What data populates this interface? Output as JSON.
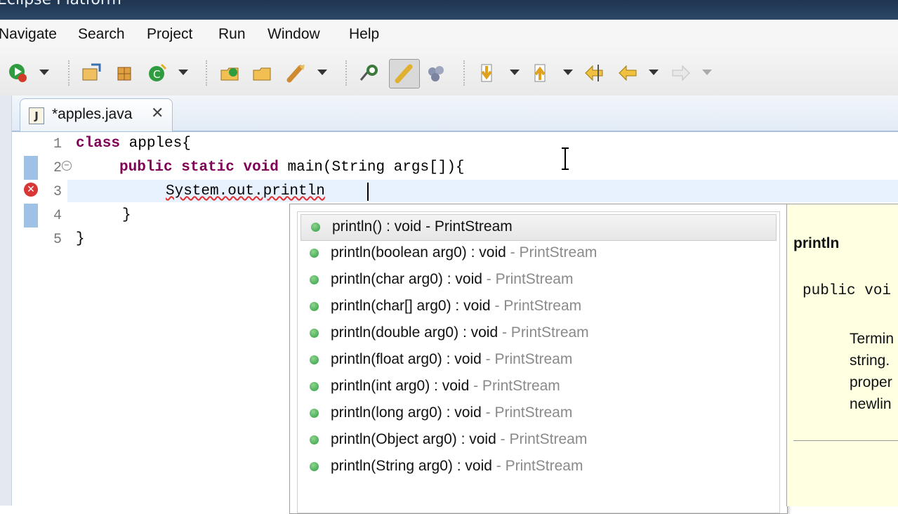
{
  "window": {
    "title": "Eclipse Platform"
  },
  "menu": [
    "Navigate",
    "Search",
    "Project",
    "Run",
    "Window",
    "Help"
  ],
  "toolbar": {
    "icons": [
      "run-icon",
      "new-java-project-icon",
      "new-package-icon",
      "new-class-icon",
      "open-type-icon",
      "open-folder-icon",
      "search-tool-icon",
      "debug-icon",
      "highlight-icon",
      "breakpoints-icon",
      "next-annotation-icon",
      "previous-annotation-icon",
      "last-edit-location-icon",
      "back-icon",
      "forward-icon"
    ]
  },
  "editor": {
    "tab_label": "*apples.java",
    "tab_icon": "J",
    "lines": [
      {
        "num": "1",
        "text": "class apples{"
      },
      {
        "num": "2",
        "text": "public static void main(String args[]){"
      },
      {
        "num": "3",
        "text": "System.out.println"
      },
      {
        "num": "4",
        "text": "}"
      },
      {
        "num": "5",
        "text": "}"
      }
    ]
  },
  "content_assist": {
    "proposals": [
      {
        "sig": "println() : void",
        "type": "- PrintStream"
      },
      {
        "sig": "println(boolean arg0) : void",
        "type": "- PrintStream"
      },
      {
        "sig": "println(char arg0) : void",
        "type": "- PrintStream"
      },
      {
        "sig": "println(char[] arg0) : void",
        "type": "- PrintStream"
      },
      {
        "sig": "println(double arg0) : void",
        "type": "- PrintStream"
      },
      {
        "sig": "println(float arg0) : void",
        "type": "- PrintStream"
      },
      {
        "sig": "println(int arg0) : void",
        "type": "- PrintStream"
      },
      {
        "sig": "println(long arg0) : void",
        "type": "- PrintStream"
      },
      {
        "sig": "println(Object arg0) : void",
        "type": "- PrintStream"
      },
      {
        "sig": "println(String arg0) : void",
        "type": "- PrintStream"
      }
    ],
    "selected_index": 0
  },
  "doc": {
    "title": "println",
    "signature": "public voi",
    "lines": [
      "Termin",
      "string.",
      "proper",
      "newlin"
    ]
  }
}
